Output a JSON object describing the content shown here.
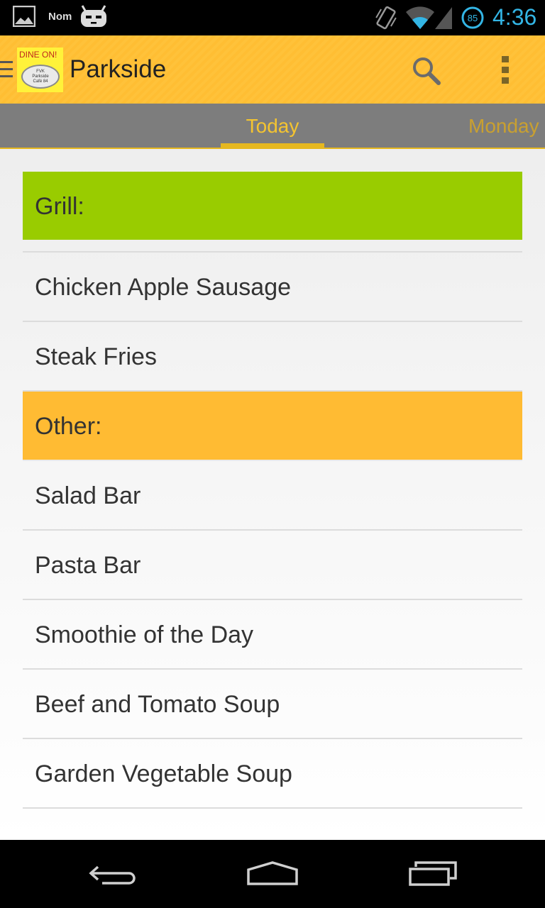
{
  "status_bar": {
    "notification_text": "Nom",
    "time": "4:36",
    "battery_percent": "85",
    "icons": [
      "gallery-icon",
      "cyanogenmod-icon",
      "vibrate-icon",
      "wifi-icon",
      "signal-icon",
      "battery-icon"
    ]
  },
  "action_bar": {
    "title": "Parkside",
    "logo": {
      "title": "DINE ON!",
      "plate_text": "FVK\nParkside\nCafé 84"
    },
    "icons": [
      "search-icon",
      "overflow-menu-icon"
    ]
  },
  "tabs": {
    "current": "Today",
    "next": "Monday"
  },
  "menu": {
    "sections": [
      {
        "header": "Grill:",
        "color": "#99cc00",
        "items": [
          "Chicken Apple Sausage",
          "Steak Fries"
        ]
      },
      {
        "header": "Other:",
        "color": "#ffbb33",
        "items": [
          "Salad Bar",
          "Pasta Bar",
          "Smoothie of the Day",
          "Beef and Tomato Soup",
          "Garden Vegetable Soup"
        ]
      }
    ]
  },
  "theme": {
    "accent": "#ffbb33",
    "status_time_color": "#33b5e5",
    "tab_indicator": "#e6b820"
  }
}
